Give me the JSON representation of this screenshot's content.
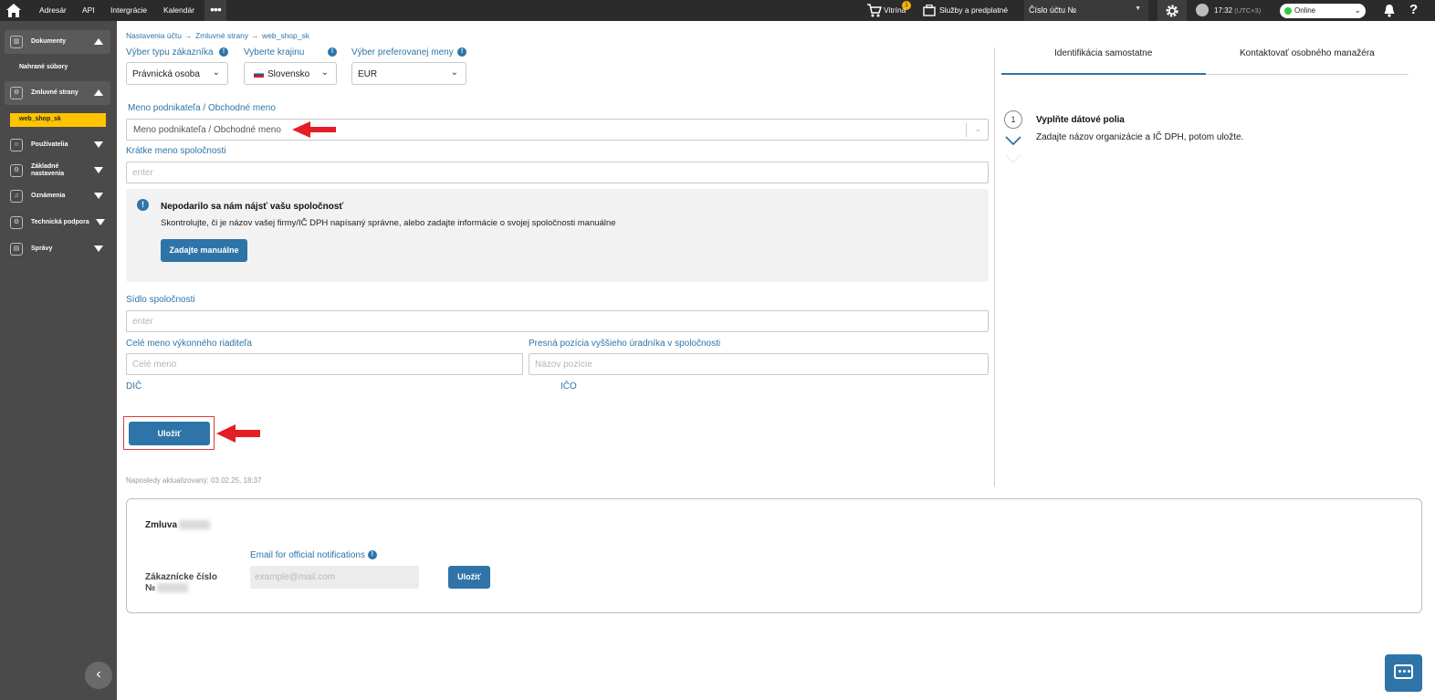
{
  "topbar": {
    "nav": [
      "Adresár",
      "API",
      "Intergrácie",
      "Kalendár"
    ],
    "more": "•••",
    "storefront": "Vitrína",
    "storefront_badge": "1",
    "services": "Služby a predplatné",
    "account_no": "Číslo účtu №",
    "time": "17:32",
    "timezone": "(UTC+3)",
    "status": "Online",
    "help": "?"
  },
  "sidebar": {
    "documents": "Dokumenty",
    "uploaded": "Nahrané súbory",
    "parties": "Zmluvné strany",
    "active_party": "web_shop_sk",
    "users": "Používatelia",
    "basic_settings_1": "Základné",
    "basic_settings_2": "nastavenia",
    "notifications": "Oznámenia",
    "support": "Technická podpora",
    "reports": "Správy",
    "collapse": "‹"
  },
  "breadcrumb": {
    "item1": "Nastavenia účtu",
    "item2": "Zmluvné strany",
    "item3": "web_shop_sk",
    "sep": "→"
  },
  "form": {
    "customer_type_label": "Výber typu zákazníka",
    "customer_type_value": "Právnická osoba",
    "country_label": "Vyberte krajinu",
    "country_value": "Slovensko",
    "currency_label": "Výber preferovanej meny",
    "currency_value": "EUR",
    "business_name_label": "Meno podnikateľa / Obchodné meno",
    "business_name_placeholder": "Meno podnikateľa / Obchodné meno",
    "short_name_label": "Krátke meno spoločnosti",
    "short_name_placeholder": "enter",
    "address_label": "Sídlo spoločnosti",
    "address_placeholder": "enter",
    "ceo_label": "Celé meno výkonného riaditeľa",
    "ceo_placeholder": "Celé meno",
    "position_label": "Presná pozícia vyššieho úradníka v spoločnosti",
    "position_placeholder": "Názov pozície",
    "dic_label": "DIČ",
    "ico_label": "IČO",
    "save": "Uložiť",
    "updated": "Naposledy aktualizovaný: 03.02.25, 18:37"
  },
  "alert": {
    "icon": "!",
    "title": "Nepodarilo sa nám nájsť vašu spoločnosť",
    "message": "Skontrolujte, či je názov vašej firmy/IČ DPH napísaný správne, alebo zadajte informácie o svojej spoločnosti manuálne",
    "button": "Zadajte manuálne"
  },
  "right_panel": {
    "tab1": "Identifikácia samostatne",
    "tab2": "Kontaktovať osobného manažéra",
    "step_number": "1",
    "step_title": "Vyplňte dátové polia",
    "step_desc": "Zadajte názov organizácie a IČ DPH, potom uložte."
  },
  "contract": {
    "title": "Zmluva",
    "customer_no_1": "Zákaznícke číslo",
    "customer_no_2": "№",
    "email_label": "Email for official notifications",
    "email_placeholder": "example@mail.com",
    "save": "Uložiť"
  },
  "colors": {
    "accent": "#2e74a8",
    "sidebar": "#4a4a4a",
    "topbar": "#2b2b2b",
    "highlight": "#ffc400",
    "annotation_red": "#e53935"
  }
}
